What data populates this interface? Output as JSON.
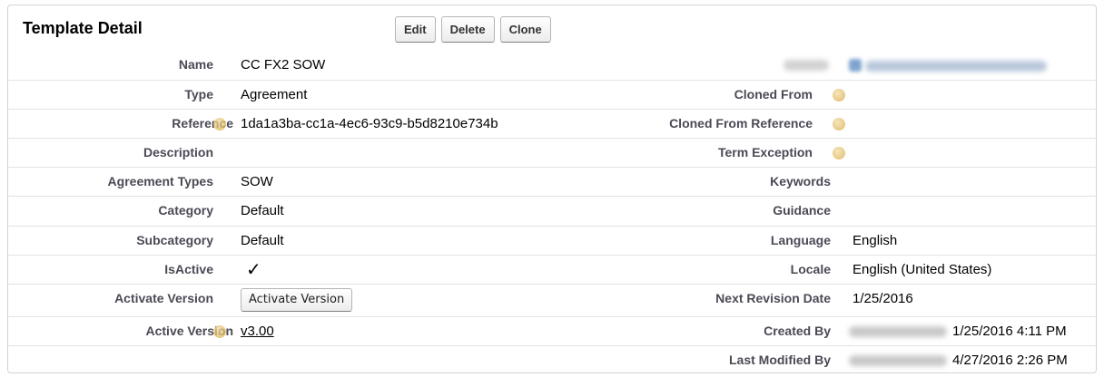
{
  "header": {
    "title": "Template Detail",
    "buttons": {
      "edit": "Edit",
      "delete": "Delete",
      "clone": "Clone"
    }
  },
  "left": {
    "name": {
      "label": "Name",
      "value": "CC FX2 SOW"
    },
    "type": {
      "label": "Type",
      "value": "Agreement"
    },
    "reference": {
      "label": "Reference",
      "value": "1da1a3ba-cc1a-4ec6-93c9-b5d8210e734b"
    },
    "description": {
      "label": "Description",
      "value": ""
    },
    "agreement_types": {
      "label": "Agreement Types",
      "value": "SOW"
    },
    "category": {
      "label": "Category",
      "value": "Default"
    },
    "subcategory": {
      "label": "Subcategory",
      "value": "Default"
    },
    "is_active": {
      "label": "IsActive",
      "value": "✓"
    },
    "activate_version": {
      "label": "Activate Version",
      "button": "Activate Version"
    },
    "active_version": {
      "label": "Active Version",
      "value": "v3.00"
    }
  },
  "right": {
    "cloned_from": {
      "label": "Cloned From",
      "value": ""
    },
    "cloned_from_reference": {
      "label": "Cloned From Reference",
      "value": ""
    },
    "term_exception": {
      "label": "Term Exception",
      "value": ""
    },
    "keywords": {
      "label": "Keywords",
      "value": ""
    },
    "guidance": {
      "label": "Guidance",
      "value": ""
    },
    "language": {
      "label": "Language",
      "value": "English"
    },
    "locale": {
      "label": "Locale",
      "value": "English (United States)"
    },
    "next_revision_date": {
      "label": "Next Revision Date",
      "value": "1/25/2016"
    },
    "created_by": {
      "label": "Created By",
      "date": "1/25/2016 4:11 PM"
    },
    "last_modified_by": {
      "label": "Last Modified By",
      "date": "4/27/2016 2:26 PM"
    }
  },
  "colors": {
    "label_text": "#4a4a56",
    "border": "#cfd4d9",
    "help_icon": "#e0b85a"
  }
}
